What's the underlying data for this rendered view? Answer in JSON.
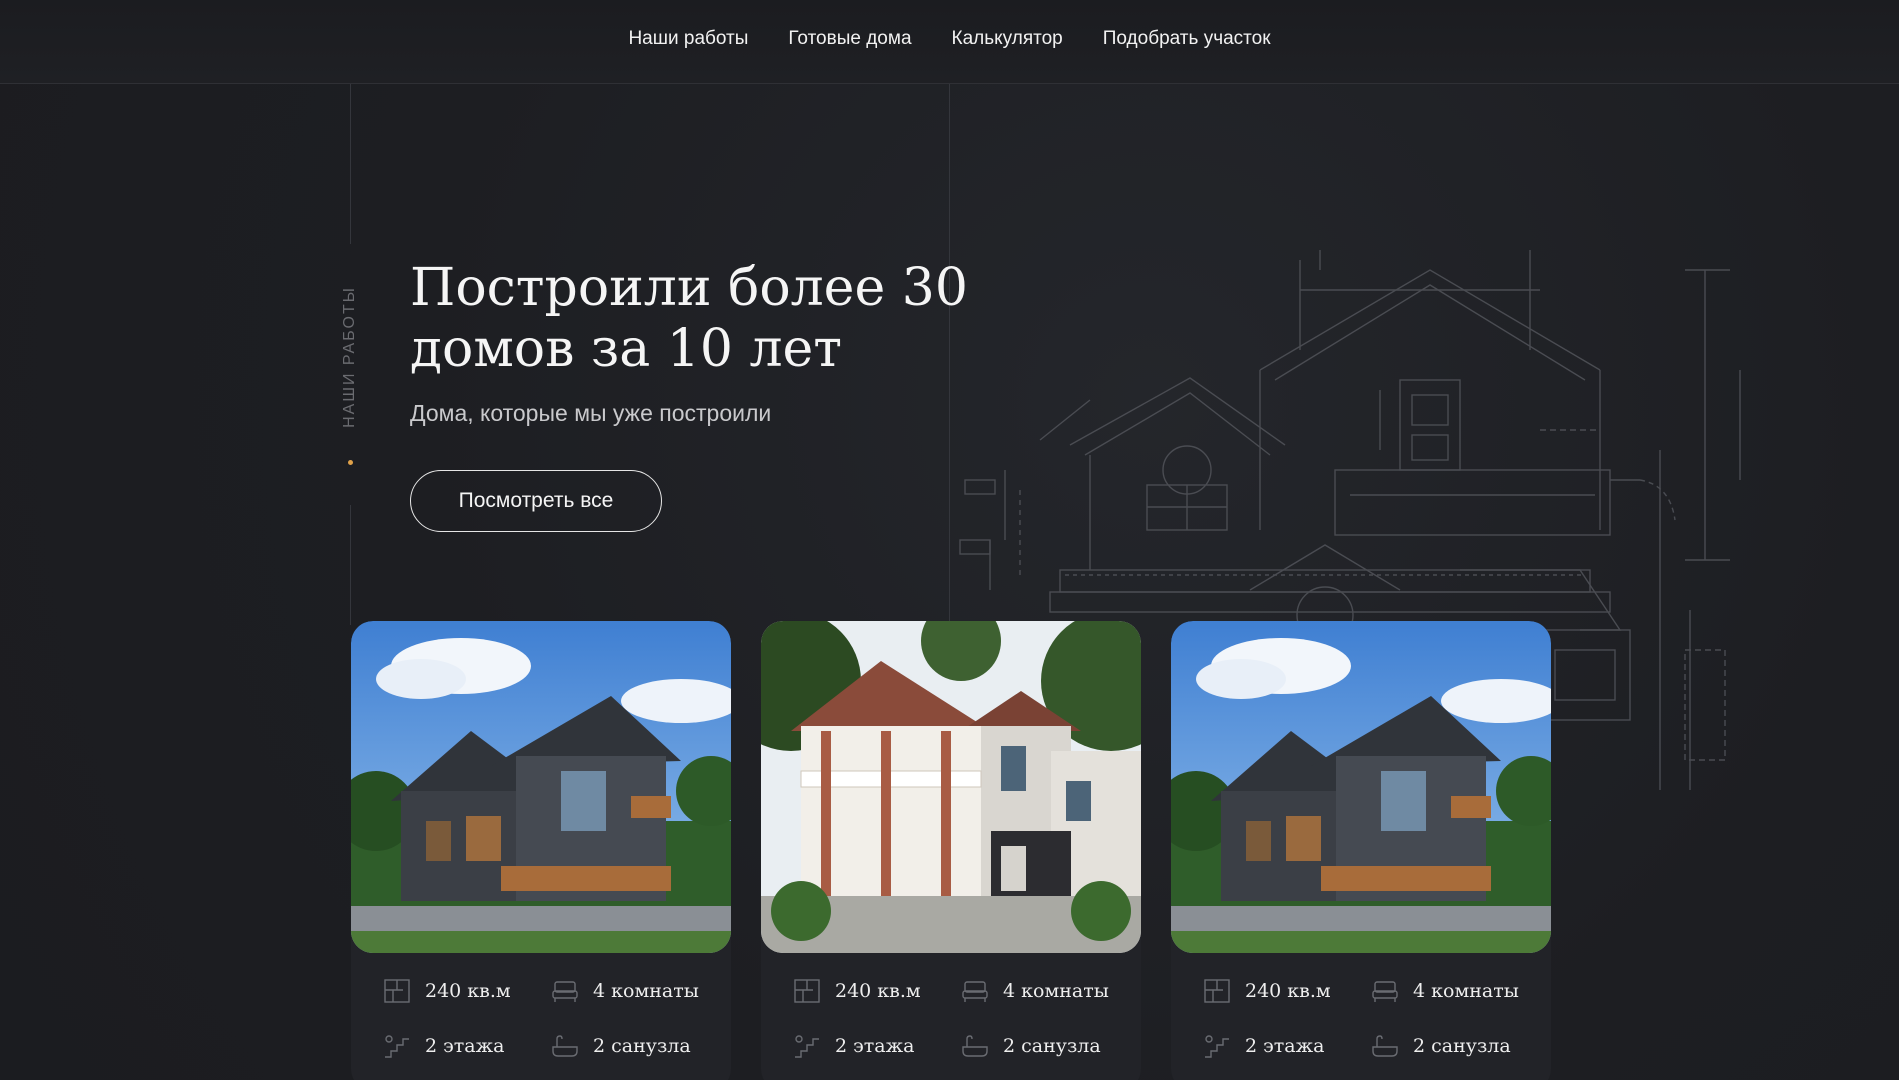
{
  "nav": {
    "items": [
      {
        "label": "Наши работы"
      },
      {
        "label": "Готовые дома"
      },
      {
        "label": "Калькулятор"
      },
      {
        "label": "Подобрать участок"
      }
    ]
  },
  "side_label": "НАШИ РАБОТЫ",
  "hero": {
    "title": "Построили более 30 домов за 10 лет",
    "subtitle": "Дома, которые мы уже построили",
    "button": "Посмотреть все"
  },
  "cards": [
    {
      "area": "240 кв.м",
      "rooms": "4 комнаты",
      "floors": "2 этажа",
      "baths": "2 санузла"
    },
    {
      "area": "240 кв.м",
      "rooms": "4 комнаты",
      "floors": "2 этажа",
      "baths": "2 санузла"
    },
    {
      "area": "240 кв.м",
      "rooms": "4 комнаты",
      "floors": "2 этажа",
      "baths": "2 санузла"
    }
  ],
  "colors": {
    "background": "#1d1e22",
    "accent_dot": "#e0a24a",
    "text": "#f2f2f2"
  },
  "icons": {
    "area": "floor-plan-icon",
    "rooms": "bed-icon",
    "floors": "stairs-icon",
    "baths": "bathtub-icon"
  }
}
